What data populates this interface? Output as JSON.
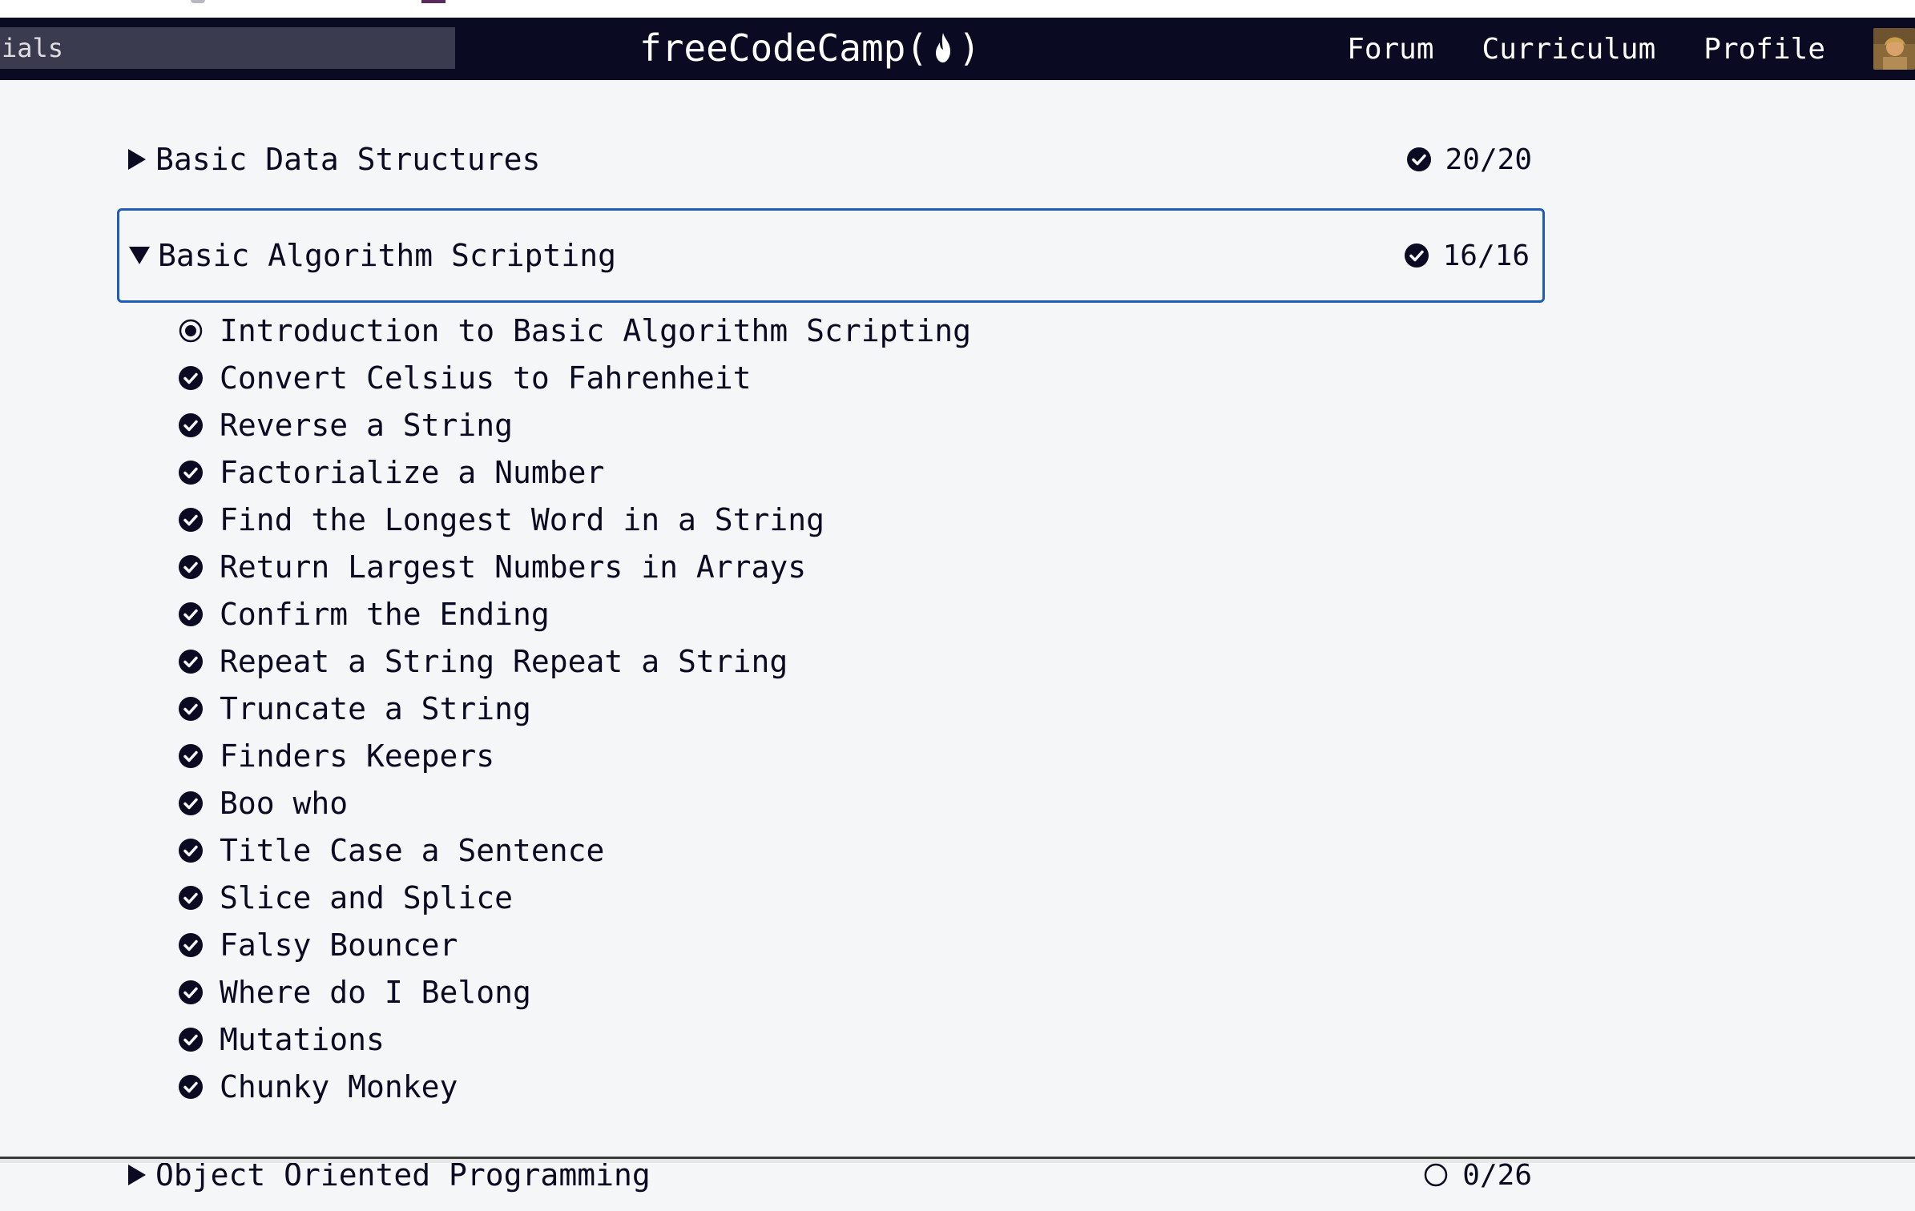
{
  "search": {
    "value": "ials"
  },
  "navbar": {
    "brand_left": "freeCodeCamp(",
    "brand_right": ")",
    "links": [
      "Forum",
      "Curriculum",
      "Profile"
    ]
  },
  "blocks": [
    {
      "title": "Basic Data Structures",
      "progress": "20/20",
      "expanded": false
    },
    {
      "title": "Basic Algorithm Scripting",
      "progress": "16/16",
      "expanded": true
    },
    {
      "title": "Object Oriented Programming",
      "progress": "0/26",
      "expanded": false
    }
  ],
  "challenges": [
    {
      "title": "Introduction to Basic Algorithm Scripting",
      "status": "current"
    },
    {
      "title": "Convert Celsius to Fahrenheit",
      "status": "completed"
    },
    {
      "title": "Reverse a String",
      "status": "completed"
    },
    {
      "title": "Factorialize a Number",
      "status": "completed"
    },
    {
      "title": "Find the Longest Word in a String",
      "status": "completed"
    },
    {
      "title": "Return Largest Numbers in Arrays",
      "status": "completed"
    },
    {
      "title": "Confirm the Ending",
      "status": "completed"
    },
    {
      "title": "Repeat a String Repeat a String",
      "status": "completed"
    },
    {
      "title": "Truncate a String",
      "status": "completed"
    },
    {
      "title": "Finders Keepers",
      "status": "completed"
    },
    {
      "title": "Boo who",
      "status": "completed"
    },
    {
      "title": "Title Case a Sentence",
      "status": "completed"
    },
    {
      "title": "Slice and Splice",
      "status": "completed"
    },
    {
      "title": "Falsy Bouncer",
      "status": "completed"
    },
    {
      "title": "Where do I Belong",
      "status": "completed"
    },
    {
      "title": "Mutations",
      "status": "completed"
    },
    {
      "title": "Chunky Monkey",
      "status": "completed"
    }
  ],
  "colors": {
    "navbar": "#0a0a23",
    "search_bg": "#3b3b4f",
    "page_bg": "#f5f6f7",
    "text": "#0a0a23",
    "focus_border": "#1f5db8"
  },
  "icons": {
    "completed": "check-circle-icon",
    "current": "radio-dot-icon",
    "not_started": "empty-circle-icon",
    "collapsed": "caret-right-icon",
    "expanded": "caret-down-icon"
  }
}
